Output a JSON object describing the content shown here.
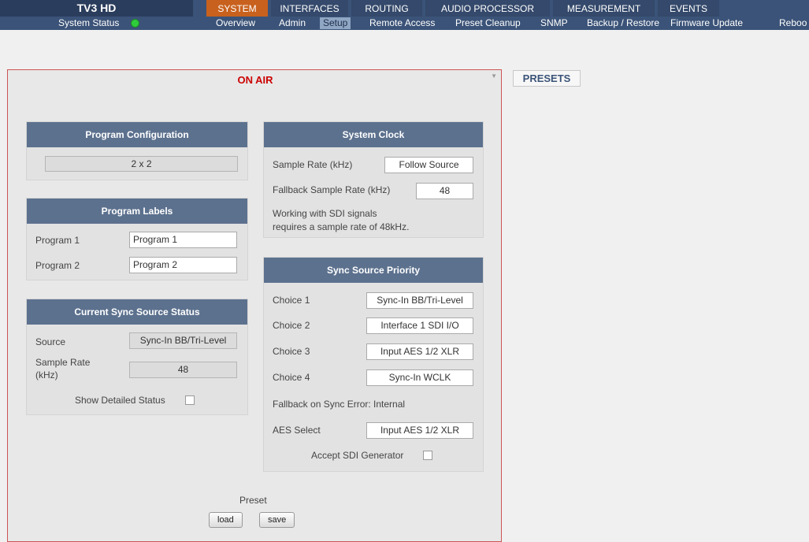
{
  "brand": "TV3 HD",
  "main_tabs": [
    {
      "label": "SYSTEM",
      "active": true
    },
    {
      "label": "INTERFACES",
      "active": false
    },
    {
      "label": "ROUTING",
      "active": false
    },
    {
      "label": "AUDIO PROCESSOR",
      "active": false
    },
    {
      "label": "MEASUREMENT",
      "active": false
    },
    {
      "label": "EVENTS",
      "active": false
    }
  ],
  "subnav": {
    "status_label": "System Status",
    "status_color": "#2fcc3b",
    "items": [
      {
        "label": "Overview",
        "active": false
      },
      {
        "label": "Admin",
        "active": false
      },
      {
        "label": "Setup",
        "active": true
      },
      {
        "label": "Remote Access",
        "active": false
      },
      {
        "label": "Preset Cleanup",
        "active": false
      },
      {
        "label": "SNMP",
        "active": false
      },
      {
        "label": "Backup / Restore",
        "active": false
      },
      {
        "label": "Firmware Update",
        "active": false
      },
      {
        "label": "Reboo",
        "active": false
      }
    ]
  },
  "onair": {
    "title": "ON AIR",
    "program_configuration": {
      "title": "Program Configuration",
      "value": "2 x 2"
    },
    "program_labels": {
      "title": "Program Labels",
      "program1_label": "Program 1",
      "program1_value": "Program 1",
      "program2_label": "Program 2",
      "program2_value": "Program 2"
    },
    "sync_status": {
      "title": "Current Sync Source Status",
      "source_label": "Source",
      "source_value": "Sync-In BB/Tri-Level",
      "sample_rate_label_1": "Sample Rate",
      "sample_rate_label_2": "(kHz)",
      "sample_rate_value": "48",
      "show_detailed_label": "Show Detailed Status"
    },
    "system_clock": {
      "title": "System Clock",
      "sample_rate_label": "Sample Rate (kHz)",
      "sample_rate_value": "Follow Source",
      "fallback_label": "Fallback Sample Rate (kHz)",
      "fallback_value": "48",
      "note_line1": "Working with SDI signals",
      "note_line2": "requires a sample rate of 48kHz."
    },
    "sync_priority": {
      "title": "Sync Source Priority",
      "choice1_label": "Choice 1",
      "choice1_value": "Sync-In BB/Tri-Level",
      "choice2_label": "Choice 2",
      "choice2_value": "Interface 1 SDI I/O",
      "choice3_label": "Choice 3",
      "choice3_value": "Input AES 1/2 XLR",
      "choice4_label": "Choice 4",
      "choice4_value": "Sync-In WCLK",
      "fallback_note": "Fallback on Sync Error: Internal",
      "aes_select_label": "AES Select",
      "aes_select_value": "Input AES 1/2 XLR",
      "accept_sdi_label": "Accept SDI Generator"
    },
    "preset": {
      "label": "Preset",
      "load": "load",
      "save": "save"
    }
  },
  "presets_tab": "PRESETS"
}
